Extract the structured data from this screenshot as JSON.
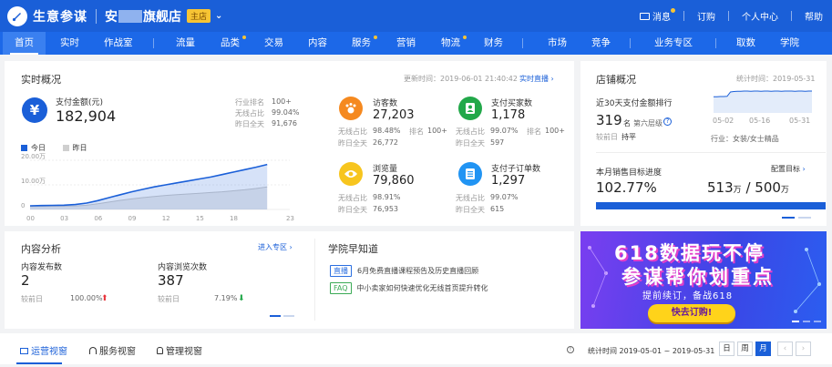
{
  "header": {
    "brand": "生意参谋",
    "shop_prefix": "安",
    "shop_suffix": "旗舰店",
    "shop_tag": "主店",
    "messages": "消息",
    "subscribe": "订购",
    "personal_center": "个人中心",
    "help": "帮助"
  },
  "nav": {
    "items": [
      "首页",
      "实时",
      "作战室",
      "流量",
      "品类",
      "交易",
      "内容",
      "服务",
      "营销",
      "物流",
      "财务",
      "市场",
      "竞争",
      "业务专区",
      "取数",
      "学院"
    ],
    "active": "首页"
  },
  "realtime": {
    "title": "实时概况",
    "updated": "更新时间：2019-06-01 21:40:42",
    "live_link": "实时直播",
    "pay_amount": {
      "label": "支付金额(元)",
      "value": "182,904",
      "rank_label": "行业排名",
      "rank_value": "100+",
      "wireless_label": "无线占比",
      "wireless_value": "99.04%",
      "yesterday_label": "昨日全天",
      "yesterday_value": "91,676"
    },
    "legend_today": "今日",
    "legend_yesterday": "昨日",
    "y_ticks": [
      "20.00万",
      "10.00万",
      "0"
    ],
    "x_ticks": [
      "00",
      "03",
      "06",
      "09",
      "12",
      "15",
      "18",
      "23"
    ],
    "metrics": [
      {
        "label": "访客数",
        "value": "27,203",
        "wireless_label": "无线占比",
        "wireless_value": "98.48%",
        "rank_label": "排名",
        "rank_value": "100+",
        "yesterday_label": "昨日全天",
        "yesterday_value": "26,772"
      },
      {
        "label": "支付买家数",
        "value": "1,178",
        "wireless_label": "无线占比",
        "wireless_value": "99.07%",
        "rank_label": "排名",
        "rank_value": "100+",
        "yesterday_label": "昨日全天",
        "yesterday_value": "597"
      },
      {
        "label": "浏览量",
        "value": "79,860",
        "wireless_label": "无线占比",
        "wireless_value": "98.91%",
        "yesterday_label": "昨日全天",
        "yesterday_value": "76,953"
      },
      {
        "label": "支付子订单数",
        "value": "1,297",
        "wireless_label": "无线占比",
        "wireless_value": "99.07%",
        "yesterday_label": "昨日全天",
        "yesterday_value": "615"
      }
    ]
  },
  "chart_data": {
    "type": "area",
    "x": [
      "00",
      "01",
      "02",
      "03",
      "04",
      "05",
      "06",
      "07",
      "08",
      "09",
      "10",
      "11",
      "12",
      "13",
      "14",
      "15",
      "16",
      "17",
      "18",
      "19",
      "20",
      "21"
    ],
    "x_ticks": [
      "00",
      "03",
      "06",
      "09",
      "12",
      "15",
      "18",
      "23"
    ],
    "y_ticks": [
      "20.00万",
      "10.00万",
      "0"
    ],
    "ylim": [
      0,
      200000
    ],
    "series": [
      {
        "name": "今日",
        "values": [
          15000,
          15800,
          16500,
          17500,
          20000,
          26000,
          36000,
          48000,
          60000,
          72000,
          82000,
          92000,
          100000,
          108000,
          116000,
          124000,
          132000,
          142000,
          152000,
          162000,
          172000,
          182904
        ]
      },
      {
        "name": "昨日",
        "values": [
          12000,
          12500,
          13000,
          13500,
          14500,
          17000,
          23000,
          30000,
          37000,
          43000,
          48000,
          53000,
          57000,
          60000,
          63000,
          66000,
          69000,
          72000,
          76000,
          80000,
          85000,
          91676
        ]
      }
    ]
  },
  "store": {
    "title": "店铺概况",
    "stat_time": "统计时间：2019-05-31",
    "rank_title": "近30天支付金额排行",
    "rank_value": "319",
    "rank_unit": "名",
    "level": "第六层级",
    "compare_label": "较前日",
    "compare_value": "持平",
    "spark_x": [
      "05-02",
      "05-16",
      "05-31"
    ],
    "industry": "行业：女装/女士精品",
    "spark_values": [
      60,
      60,
      61,
      61,
      62,
      80,
      82,
      83,
      83,
      84,
      84,
      83,
      84,
      84,
      83,
      84,
      84,
      83,
      84,
      84,
      83,
      84,
      84,
      84,
      83,
      84,
      84,
      83,
      84,
      84
    ],
    "target_title": "本月销售目标进度",
    "target_config": "配置目标",
    "target_pct": "102.77%",
    "target_done": "513",
    "target_unit1": "万",
    "target_sep": "/",
    "target_total": "500",
    "target_unit2": "万",
    "progress": 1.0
  },
  "content": {
    "title": "内容分析",
    "enter": "进入专区",
    "posts_label": "内容发布数",
    "posts_value": "2",
    "posts_cmp_label": "较前日",
    "posts_cmp_value": "100.00%",
    "views_label": "内容浏览次数",
    "views_value": "387",
    "views_cmp_label": "较前日",
    "views_cmp_value": "7.19%"
  },
  "academy": {
    "title": "学院早知道",
    "items": [
      {
        "tag": "直播",
        "text": "6月免费直播课程预告及历史直播回顾",
        "color": "#2a6ee0"
      },
      {
        "tag": "FAQ",
        "text": "中小卖家如何快速优化无线首页提升转化",
        "color": "#3aaa55"
      }
    ]
  },
  "banner": {
    "line1": "618数据玩不停",
    "line2": "参谋帮你划重点",
    "line3": "提前续订，备战618",
    "button": "快去订购!"
  },
  "footer": {
    "tabs": [
      "运营视窗",
      "服务视窗",
      "管理视窗"
    ],
    "stat_range": "统计时间 2019-05-01 ~ 2019-05-31",
    "segments": [
      "日",
      "周",
      "月"
    ],
    "active_segment": "月"
  },
  "colors": {
    "brand_blue": "#1a5fd8",
    "up_red": "#e8343b",
    "down_green": "#22a84a"
  }
}
